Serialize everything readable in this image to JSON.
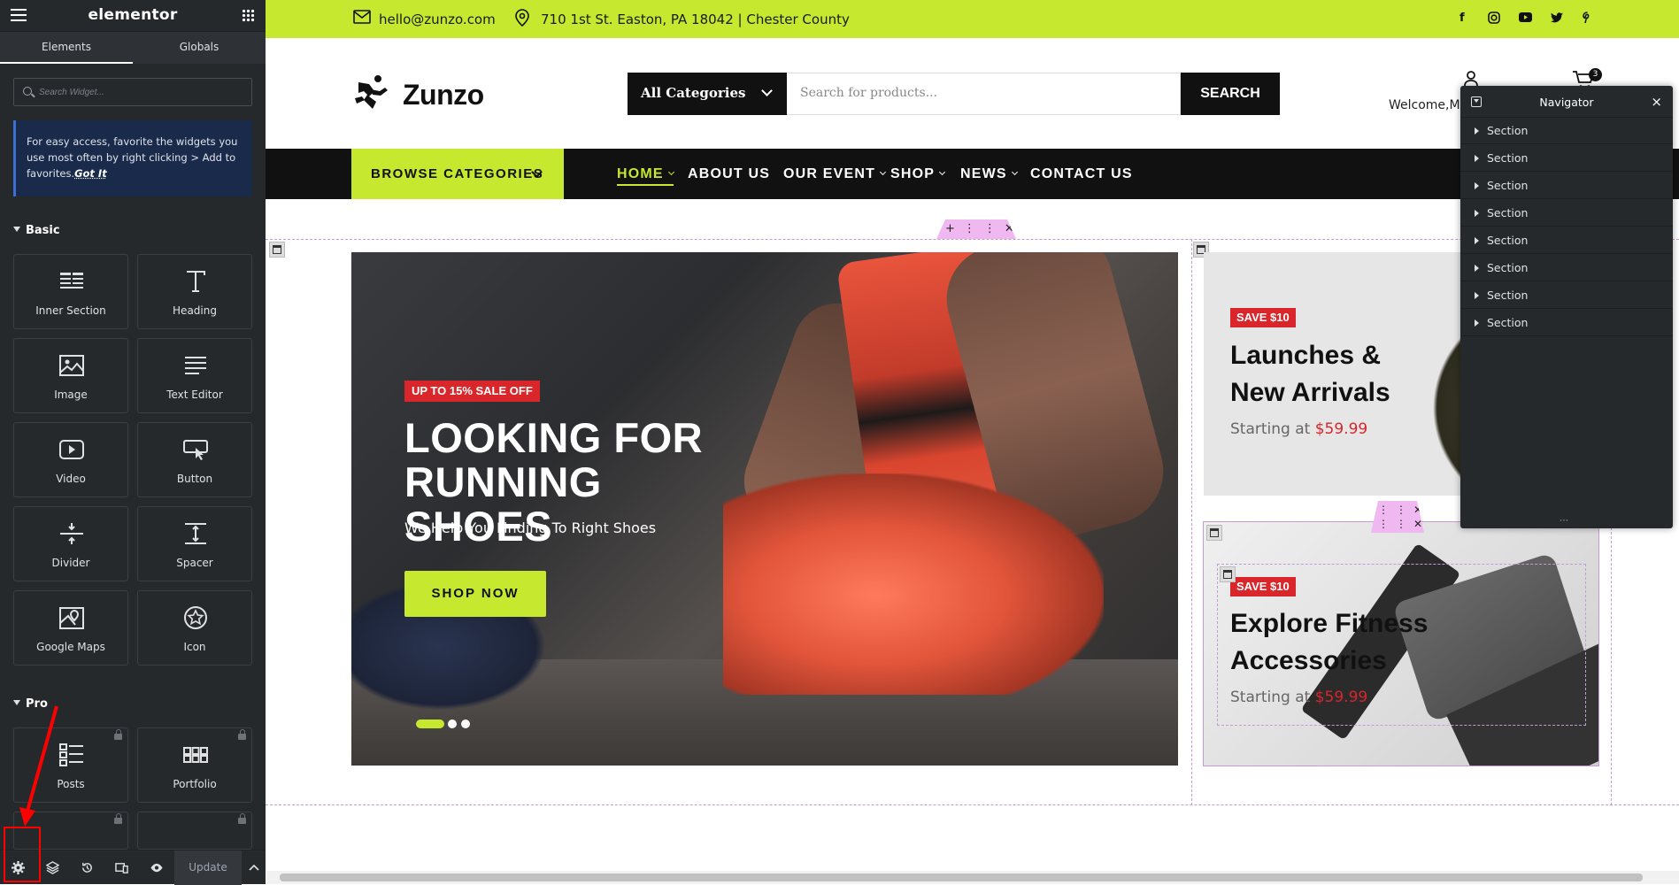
{
  "editor": {
    "logo": "elementor",
    "tabs": [
      {
        "label": "Elements"
      },
      {
        "label": "Globals"
      }
    ],
    "search_placeholder": "Search Widget...",
    "tip_text": "For easy access, favorite the widgets you use most often by right clicking > Add to favorites.",
    "tip_link": "Got It",
    "categories": {
      "basic": "Basic",
      "pro": "Pro"
    },
    "widgets": [
      {
        "label": "Inner Section",
        "icon": "inner-section-icon"
      },
      {
        "label": "Heading",
        "icon": "heading-icon"
      },
      {
        "label": "Image",
        "icon": "image-icon"
      },
      {
        "label": "Text Editor",
        "icon": "text-editor-icon"
      },
      {
        "label": "Video",
        "icon": "video-icon"
      },
      {
        "label": "Button",
        "icon": "button-icon"
      },
      {
        "label": "Divider",
        "icon": "divider-icon"
      },
      {
        "label": "Spacer",
        "icon": "spacer-icon"
      },
      {
        "label": "Google Maps",
        "icon": "map-icon"
      },
      {
        "label": "Icon",
        "icon": "star-icon"
      }
    ],
    "pro_widgets": [
      {
        "label": "Posts",
        "icon": "posts-icon"
      },
      {
        "label": "Portfolio",
        "icon": "portfolio-icon"
      }
    ],
    "bottom": {
      "update_label": "Update"
    }
  },
  "site": {
    "email": "hello@zunzo.com",
    "address": "710 1st St. Easton, PA 18042 | Chester County",
    "social": [
      "f",
      "instagram",
      "youtube",
      "twitter",
      "pinterest"
    ],
    "brand": "Zunzo",
    "category_select": "All Categories",
    "search_placeholder": "Search for products...",
    "search_button": "SEARCH",
    "welcome": "Welcome,M",
    "cart_count": "3",
    "browse": "BROWSE CATEGORIES",
    "menu": [
      {
        "label": "HOME",
        "dropdown": true
      },
      {
        "label": "ABOUT US",
        "dropdown": false
      },
      {
        "label": "OUR EVENT",
        "dropdown": true
      },
      {
        "label": "SHOP",
        "dropdown": true
      },
      {
        "label": "NEWS",
        "dropdown": true
      },
      {
        "label": "CONTACT US",
        "dropdown": false
      }
    ],
    "hero": {
      "badge": "UP TO 15% SALE OFF",
      "title_line1": "LOOKING FOR",
      "title_line2": "RUNNING SHOES",
      "subtitle": "We Help You Finding To Right Shoes",
      "button": "SHOP NOW"
    },
    "cards": [
      {
        "badge": "SAVE $10",
        "title_line1": "Launches &",
        "title_line2": "New Arrivals",
        "price_prefix": "Starting at",
        "price": "$59.99"
      },
      {
        "badge": "SAVE $10",
        "title_line1": "Explore Fitness",
        "title_line2": "Accessories",
        "price_prefix": "Starting at",
        "price": "$59.99"
      }
    ]
  },
  "navigator": {
    "title": "Navigator",
    "items": [
      "Section",
      "Section",
      "Section",
      "Section",
      "Section",
      "Section",
      "Section",
      "Section"
    ]
  },
  "colors": {
    "accent": "#c6e82e",
    "editor_bg": "#26292c",
    "sale_red": "#d8262b",
    "highlight_red": "#ff0000"
  }
}
